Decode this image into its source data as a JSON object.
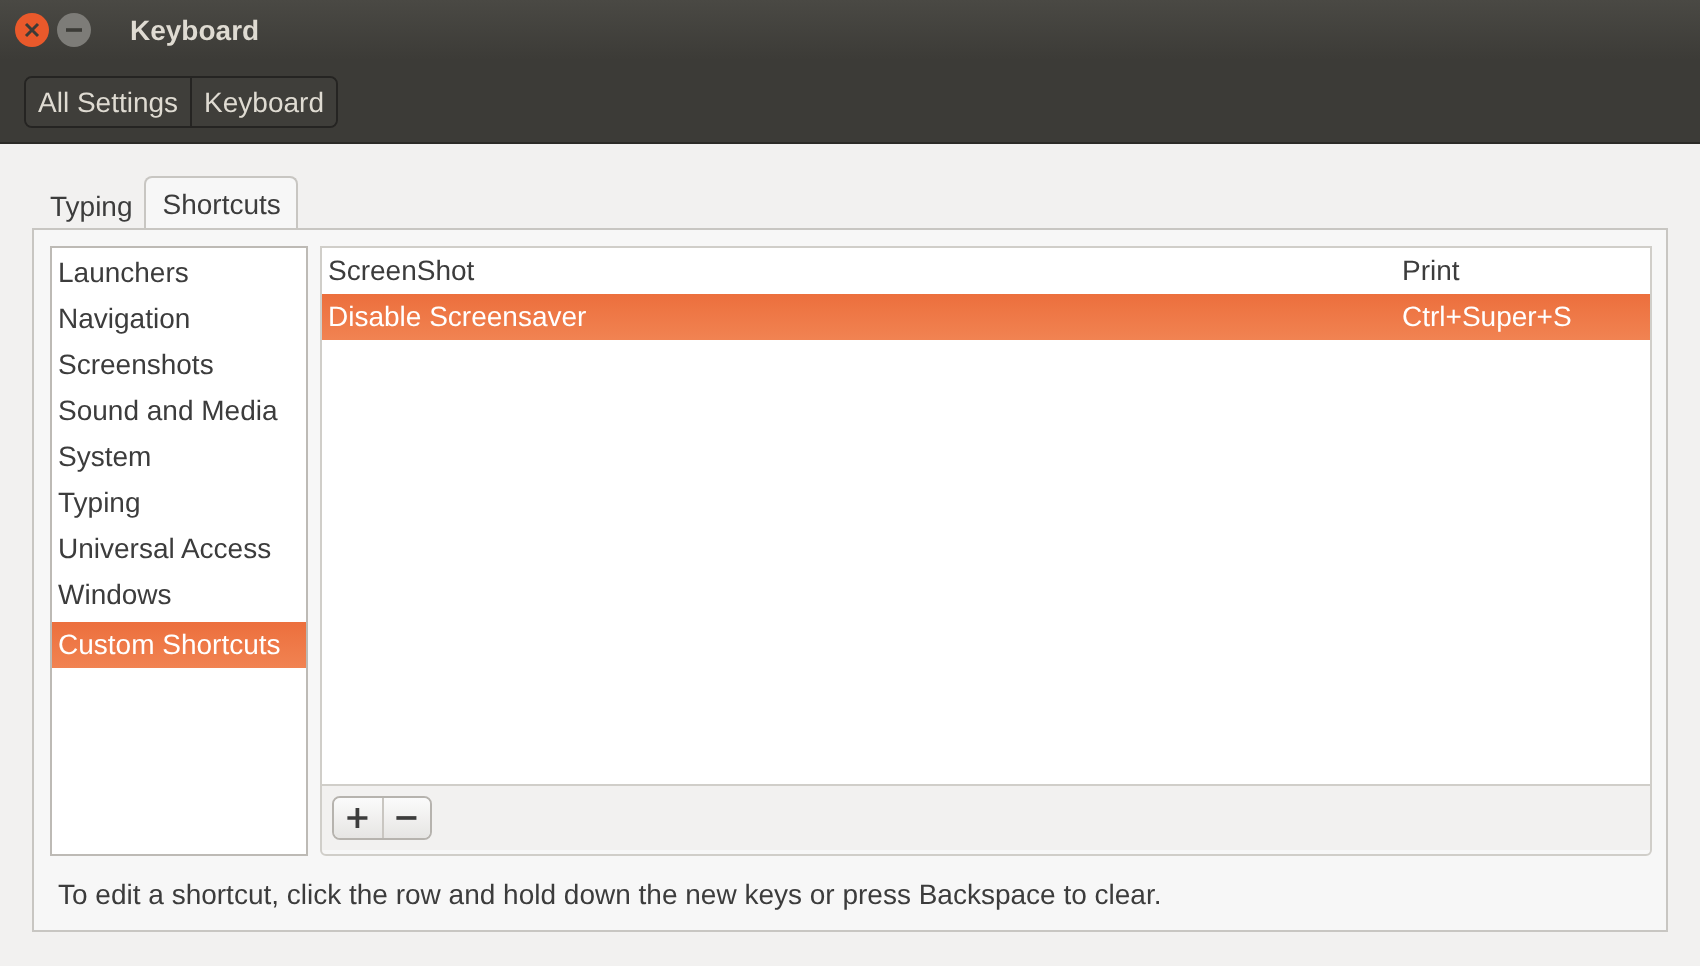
{
  "window": {
    "title": "Keyboard"
  },
  "breadcrumbs": [
    "All Settings",
    "Keyboard"
  ],
  "tabs": [
    {
      "label": "Typing",
      "selected": false
    },
    {
      "label": "Shortcuts",
      "selected": true
    }
  ],
  "categories": [
    {
      "label": "Launchers",
      "selected": false
    },
    {
      "label": "Navigation",
      "selected": false
    },
    {
      "label": "Screenshots",
      "selected": false
    },
    {
      "label": "Sound and Media",
      "selected": false
    },
    {
      "label": "System",
      "selected": false
    },
    {
      "label": "Typing",
      "selected": false
    },
    {
      "label": "Universal Access",
      "selected": false
    },
    {
      "label": "Windows",
      "selected": false
    },
    {
      "label": "Custom Shortcuts",
      "selected": true
    }
  ],
  "shortcuts": [
    {
      "action": "ScreenShot",
      "keys": "Print",
      "selected": false
    },
    {
      "action": "Disable Screensaver",
      "keys": "Ctrl+Super+S",
      "selected": true
    }
  ],
  "list_buttons": [
    "+",
    "−"
  ],
  "hint": "To edit a shortcut, click the row and hold down the new keys or press Backspace to clear."
}
